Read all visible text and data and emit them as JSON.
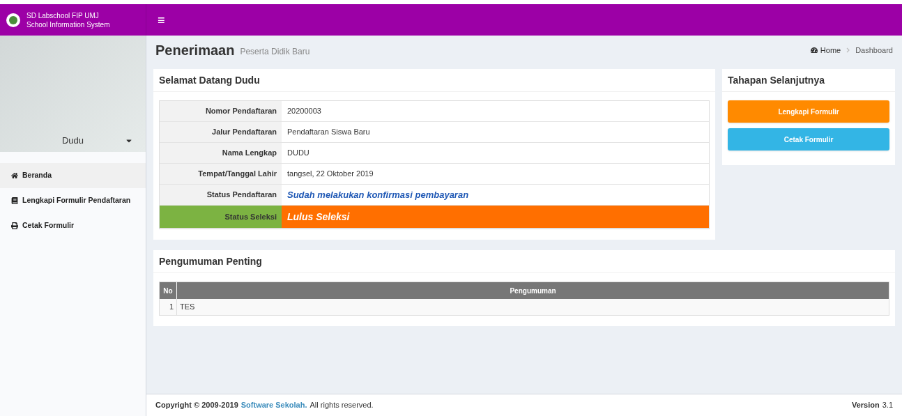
{
  "header": {
    "school_name": "SD Labschool FIP UMJ",
    "system_name": "School Information System",
    "menu_toggle": "≡"
  },
  "sidebar": {
    "user_name": "Dudu",
    "items": [
      {
        "label": "Beranda",
        "kind": "home",
        "selected": true
      },
      {
        "label": "Lengkapi Formulir Pendaftaran",
        "kind": "form",
        "selected": false
      },
      {
        "label": "Cetak Formulir",
        "kind": "print",
        "selected": false
      }
    ]
  },
  "page_header": {
    "title": "Penerimaan",
    "subtitle": "Peserta Didik Baru",
    "breadcrumb": [
      "Home",
      "Dashboard"
    ]
  },
  "welcome_panel": {
    "title": "Selamat Datang Dudu",
    "rows": [
      {
        "label": "Nomor Pendaftaran",
        "value": "20200003",
        "kind": "plain"
      },
      {
        "label": "Jalur Pendaftaran",
        "value": "Pendaftaran Siswa Baru",
        "kind": "plain"
      },
      {
        "label": "Nama Lengkap",
        "value": "DUDU",
        "kind": "plain"
      },
      {
        "label": "Tempat/Tanggal Lahir",
        "value": "tangsel, 22 Oktober 2019",
        "kind": "plain"
      },
      {
        "label": "Status Pendaftaran",
        "value": "Sudah melakukan konfirmasi pembayaran",
        "kind": "status"
      },
      {
        "label": "Status Seleksi",
        "value": "Lulus Seleksi",
        "kind": "result"
      }
    ]
  },
  "next_steps": {
    "title": "Tahapan Selanjutnya",
    "buttons": [
      {
        "label": "Lengkapi Formulir",
        "color": "#ff8a00"
      },
      {
        "label": "Cetak Formulir",
        "color": "#33b5e5"
      }
    ]
  },
  "announcements": {
    "title": "Pengumuman Penting",
    "columns": [
      "No",
      "Pengumuman"
    ],
    "rows": [
      {
        "no": "1",
        "text": "TES"
      }
    ]
  },
  "footer": {
    "copyright": "Copyright © 2009-2019",
    "link": "Software Sekolah.",
    "rights": "All rights reserved.",
    "version_label": "Version",
    "version": "3.1"
  }
}
